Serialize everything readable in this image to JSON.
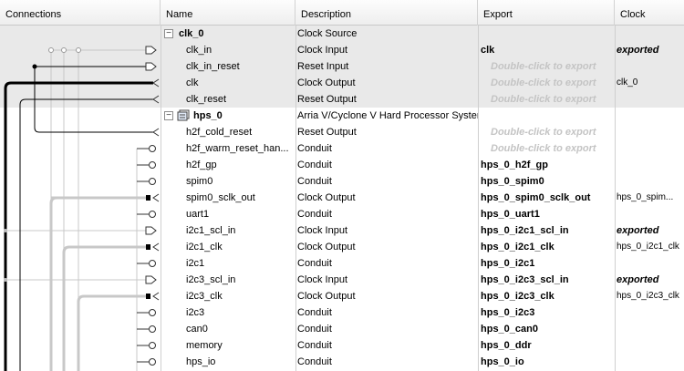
{
  "columns": {
    "connections": "Connections",
    "name": "Name",
    "description": "Description",
    "export": "Export",
    "clock": "Clock"
  },
  "rows": [
    {
      "name": "clk_0",
      "description": "Clock Source",
      "export": "",
      "clock": "",
      "type": "module",
      "expanded": true
    },
    {
      "name": "clk_in",
      "description": "Clock Input",
      "export": "clk",
      "clock": "exported",
      "type": "clock-in"
    },
    {
      "name": "clk_in_reset",
      "description": "Reset Input",
      "export": "Double-click to export",
      "clock": "",
      "type": "reset-in"
    },
    {
      "name": "clk",
      "description": "Clock Output",
      "export": "Double-click to export",
      "clock": "clk_0",
      "type": "clock-out"
    },
    {
      "name": "clk_reset",
      "description": "Reset Output",
      "export": "Double-click to export",
      "clock": "",
      "type": "reset-out"
    },
    {
      "name": "hps_0",
      "description": "Arria V/Cyclone V Hard Processor System",
      "export": "",
      "clock": "",
      "type": "module",
      "expanded": true
    },
    {
      "name": "h2f_cold_reset",
      "description": "Reset Output",
      "export": "Double-click to export",
      "clock": "",
      "type": "reset-out"
    },
    {
      "name": "h2f_warm_reset_han...",
      "description": "Conduit",
      "export": "Double-click to export",
      "clock": "",
      "type": "conduit"
    },
    {
      "name": "h2f_gp",
      "description": "Conduit",
      "export": "hps_0_h2f_gp",
      "clock": "",
      "type": "conduit"
    },
    {
      "name": "spim0",
      "description": "Conduit",
      "export": "hps_0_spim0",
      "clock": "",
      "type": "conduit"
    },
    {
      "name": "spim0_sclk_out",
      "description": "Clock Output",
      "export": "hps_0_spim0_sclk_out",
      "clock": "hps_0_spim...",
      "type": "clock-out"
    },
    {
      "name": "uart1",
      "description": "Conduit",
      "export": "hps_0_uart1",
      "clock": "",
      "type": "conduit"
    },
    {
      "name": "i2c1_scl_in",
      "description": "Clock Input",
      "export": "hps_0_i2c1_scl_in",
      "clock": "exported",
      "type": "clock-in"
    },
    {
      "name": "i2c1_clk",
      "description": "Clock Output",
      "export": "hps_0_i2c1_clk",
      "clock": "hps_0_i2c1_clk",
      "type": "clock-out"
    },
    {
      "name": "i2c1",
      "description": "Conduit",
      "export": "hps_0_i2c1",
      "clock": "",
      "type": "conduit"
    },
    {
      "name": "i2c3_scl_in",
      "description": "Clock Input",
      "export": "hps_0_i2c3_scl_in",
      "clock": "exported",
      "type": "clock-in"
    },
    {
      "name": "i2c3_clk",
      "description": "Clock Output",
      "export": "hps_0_i2c3_clk",
      "clock": "hps_0_i2c3_clk",
      "type": "clock-out"
    },
    {
      "name": "i2c3",
      "description": "Conduit",
      "export": "hps_0_i2c3",
      "clock": "",
      "type": "conduit"
    },
    {
      "name": "can0",
      "description": "Conduit",
      "export": "hps_0_can0",
      "clock": "",
      "type": "conduit"
    },
    {
      "name": "memory",
      "description": "Conduit",
      "export": "hps_0_ddr",
      "clock": "",
      "type": "conduit"
    },
    {
      "name": "hps_io",
      "description": "Conduit",
      "export": "hps_0_io",
      "clock": "",
      "type": "conduit"
    }
  ],
  "colors": {
    "grey_row": "#e9e9e9",
    "wire_light": "#c8c8c8",
    "hint_text": "#c4c4c4"
  }
}
